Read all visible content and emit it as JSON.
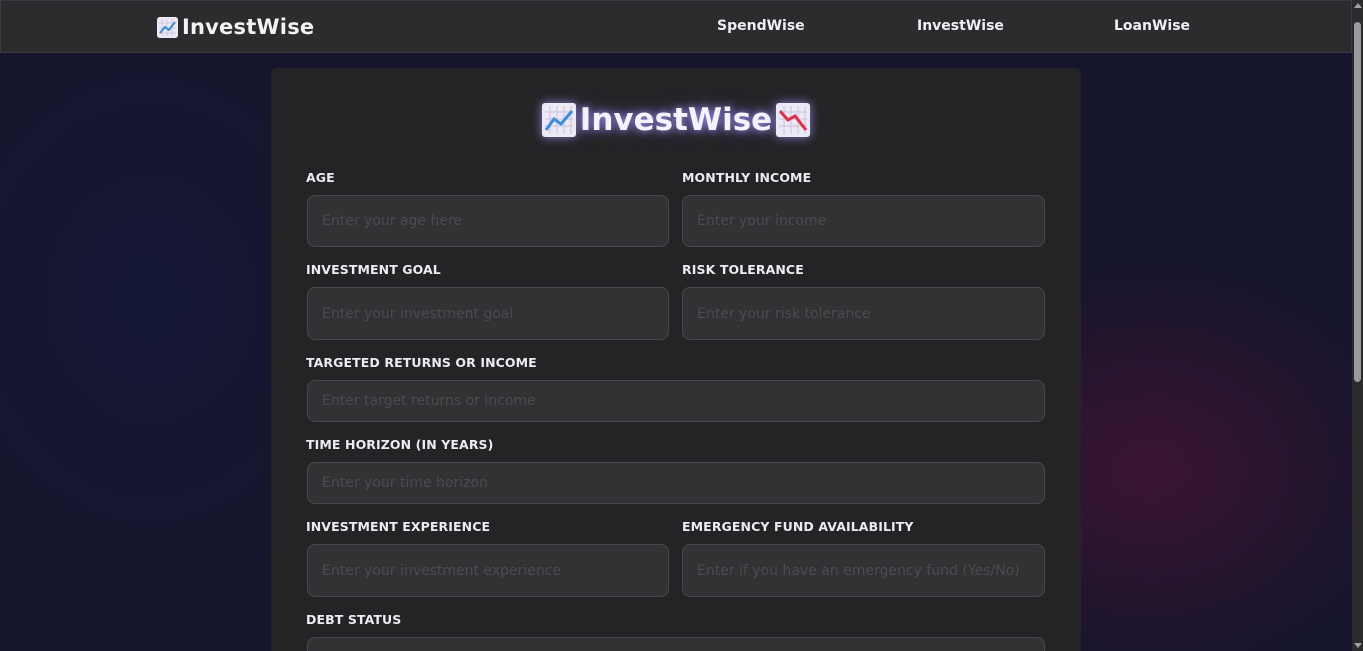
{
  "navbar": {
    "brand": "InvestWise",
    "links": [
      {
        "label": "SpendWise"
      },
      {
        "label": "InvestWise"
      },
      {
        "label": "LoanWise"
      }
    ]
  },
  "form": {
    "title": "InvestWise",
    "fields": {
      "age": {
        "label": "AGE",
        "placeholder": "Enter your age here"
      },
      "monthly_income": {
        "label": "MONTHLY INCOME",
        "placeholder": "Enter your income"
      },
      "investment_goal": {
        "label": "INVESTMENT GOAL",
        "placeholder": "Enter your investment goal"
      },
      "risk_tolerance": {
        "label": "RISK TOLERANCE",
        "placeholder": "Enter your risk tolerance"
      },
      "targeted_returns": {
        "label": "TARGETED RETURNS OR INCOME",
        "placeholder": "Enter target returns or income"
      },
      "time_horizon": {
        "label": "TIME HORIZON (IN YEARS)",
        "placeholder": "Enter your time horizon"
      },
      "investment_experience": {
        "label": "INVESTMENT EXPERIENCE",
        "placeholder": "Enter your investment experience"
      },
      "emergency_fund": {
        "label": "EMERGENCY FUND AVAILABILITY",
        "placeholder": "Enter if you have an emergency fund (Yes/No)"
      },
      "debt_status": {
        "label": "DEBT STATUS",
        "placeholder": ""
      }
    }
  },
  "icons": {
    "brand": "chart-increasing-icon",
    "title_left": "chart-increasing-icon",
    "title_right": "chart-decreasing-icon"
  },
  "colors": {
    "background": "#15152b",
    "navbar": "#2c2c2e",
    "card": "#242426",
    "input": "#323234",
    "up_line": "#3a8de0",
    "down_line": "#e0304a"
  }
}
